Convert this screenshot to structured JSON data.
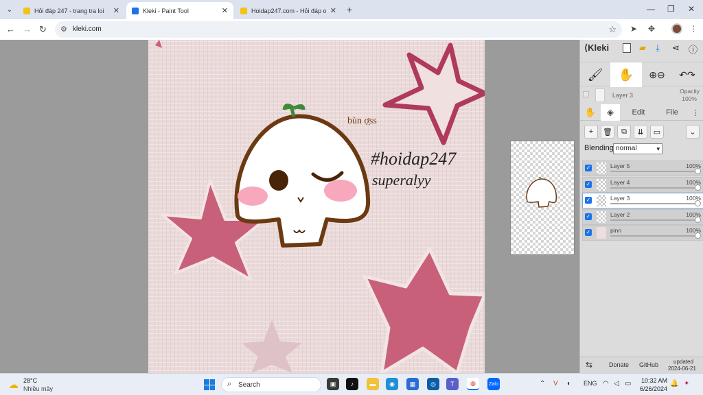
{
  "browser": {
    "tabs": [
      {
        "title": "Hỏi đáp 247 - trang tra loi",
        "active": false
      },
      {
        "title": "Kleki - Paint Tool",
        "active": true
      },
      {
        "title": "Hoidap247.com - Hỏi đáp onli",
        "active": false
      }
    ],
    "url": "kleki.com"
  },
  "canvas": {
    "caption_top": "bùn ợ̣ss",
    "hashtag": "#hoidap247",
    "signature": "superalyy"
  },
  "panel": {
    "brand": "Kleki",
    "current_layer": "Layer 3",
    "opacity_label": "Opacity",
    "opacity_value": "100%",
    "tabs": {
      "edit": "Edit",
      "file": "File"
    },
    "blending_label": "Blending",
    "blending_value": "normal",
    "layers": [
      {
        "name": "Layer 5",
        "opacity": "100%",
        "active": false
      },
      {
        "name": "Layer 4",
        "opacity": "100%",
        "active": false
      },
      {
        "name": "Layer 3",
        "opacity": "100%",
        "active": true
      },
      {
        "name": "Layer 2",
        "opacity": "100%",
        "active": false
      },
      {
        "name": "pinn",
        "opacity": "100%",
        "active": false
      }
    ],
    "footer": {
      "donate": "Donate",
      "github": "GitHub",
      "updated": "updated",
      "date": "2024-06-21"
    }
  },
  "taskbar": {
    "temperature": "28°C",
    "weather": "Nhiều mây",
    "search_label": "Search",
    "language": "ENG",
    "time": "10:32 AM",
    "date": "6/26/2024"
  },
  "colors": {
    "accent": "#1a73e8",
    "canvas_bg": "#ecdcdc",
    "star_pink": "#c9607a",
    "outline_brown": "#6b3a12"
  }
}
